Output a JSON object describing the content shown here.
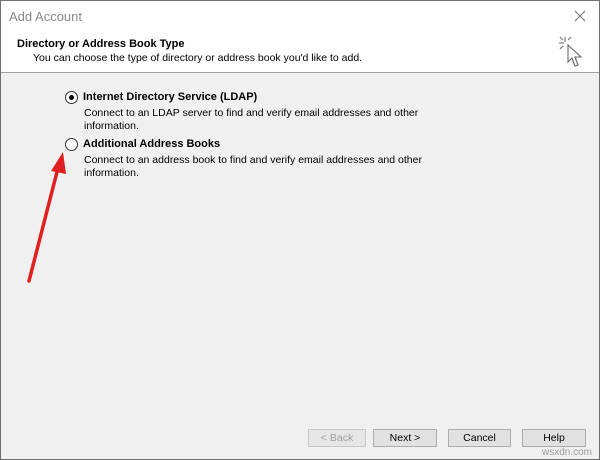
{
  "window": {
    "title": "Add Account",
    "close_icon": "close-icon"
  },
  "header": {
    "title": "Directory or Address Book Type",
    "subtitle": "You can choose the type of directory or address book you'd like to add.",
    "icon": "wizard-cursor-icon"
  },
  "options": [
    {
      "label": "Internet Directory Service (LDAP)",
      "description": "Connect to an LDAP server to find and verify email addresses and other information.",
      "checked": true
    },
    {
      "label": "Additional Address Books",
      "description": "Connect to an address book to find and verify email addresses and other information.",
      "checked": false
    }
  ],
  "buttons": {
    "back": "< Back",
    "next": "Next >",
    "cancel": "Cancel",
    "help": "Help"
  },
  "annotation": {
    "arrow_color": "#e02020"
  },
  "watermark": "wsxdn.com"
}
